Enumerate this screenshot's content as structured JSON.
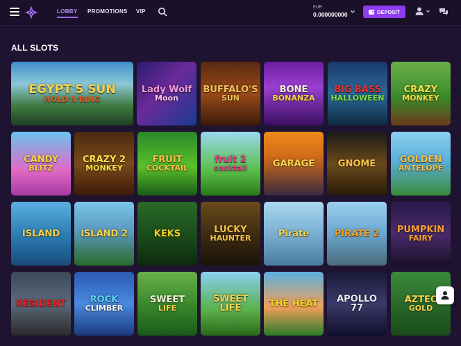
{
  "header": {
    "nav": {
      "lobby": "LOBBY",
      "promotions": "PROMOTIONS",
      "vip": "VIP"
    },
    "currency": "EUR",
    "balance": "0.000000000",
    "deposit_label": "DEPOSIT",
    "icons": [
      "hamburger-icon",
      "logo-icon",
      "search-icon",
      "chevron-down-icon",
      "wallet-icon",
      "user-icon",
      "chat-icon"
    ],
    "accent_color": "#8e3ef0"
  },
  "section_title": "ALL SLOTS",
  "games": [
    {
      "title": "EGYPT'S SUN",
      "subtitle": "HOLD'N'RING"
    },
    {
      "title": "Lady Wolf",
      "subtitle": "Moon"
    },
    {
      "title": "BUFFALO'S",
      "subtitle": "SUN"
    },
    {
      "title": "BONE",
      "subtitle": "BONANZA"
    },
    {
      "title": "BIG BASS",
      "subtitle": "HALLOWEEN"
    },
    {
      "title": "CRAZY",
      "subtitle": "MONKEY"
    },
    {
      "title": "CANDY",
      "subtitle": "BLITZ"
    },
    {
      "title": "CRAZY 2",
      "subtitle": "MONKEY"
    },
    {
      "title": "FRUIT",
      "subtitle": "COCKTAIL"
    },
    {
      "title": "fruit 2",
      "subtitle": "cocktail"
    },
    {
      "title": "GARAGE",
      "subtitle": ""
    },
    {
      "title": "GNOME",
      "subtitle": ""
    },
    {
      "title": "GOLDEN",
      "subtitle": "ANTELOPE"
    },
    {
      "title": "ISLAND",
      "subtitle": ""
    },
    {
      "title": "ISLAND 2",
      "subtitle": ""
    },
    {
      "title": "KEKS",
      "subtitle": ""
    },
    {
      "title": "LUCKY",
      "subtitle": "HAUNTER"
    },
    {
      "title": "Pirate",
      "subtitle": ""
    },
    {
      "title": "PIRATE 2",
      "subtitle": ""
    },
    {
      "title": "PUMPKIN",
      "subtitle": "FAIRY"
    },
    {
      "title": "RESIDENT",
      "subtitle": ""
    },
    {
      "title": "ROCK",
      "subtitle": "CLIMBER"
    },
    {
      "title": "SWEET",
      "subtitle": "LIFE"
    },
    {
      "title": "SWEET LIFE",
      "subtitle": ""
    },
    {
      "title": "THE HEAT",
      "subtitle": ""
    },
    {
      "title": "APOLLO 77",
      "subtitle": ""
    },
    {
      "title": "AZTEC",
      "subtitle": "GOLD"
    }
  ]
}
